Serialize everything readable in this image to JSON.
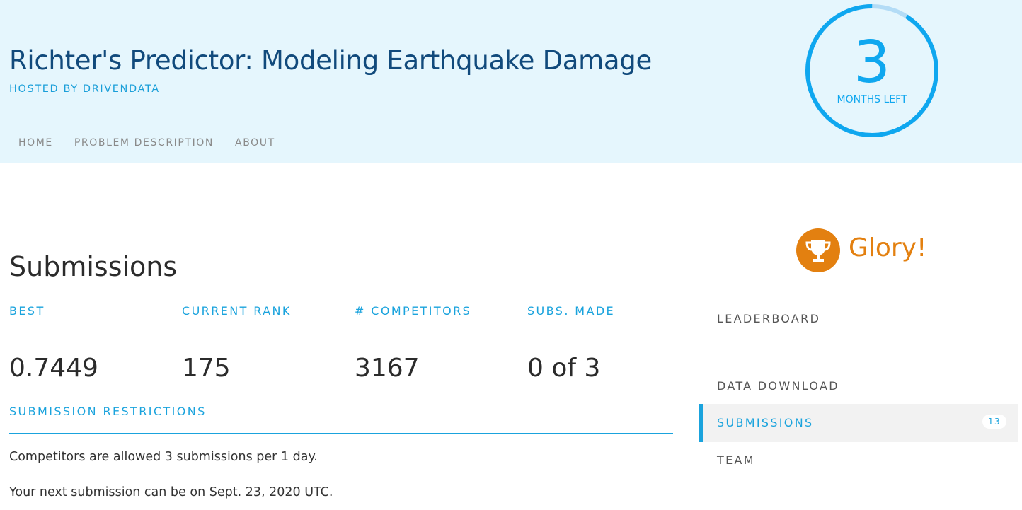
{
  "header": {
    "title": "Richter's Predictor: Modeling Earthquake Damage",
    "host": "HOSTED BY DRIVENDATA",
    "nav": [
      "HOME",
      "PROBLEM DESCRIPTION",
      "ABOUT"
    ],
    "countdown": {
      "value": "3",
      "label": "MONTHS LEFT",
      "fraction_remaining": 0.91
    }
  },
  "main": {
    "title": "Submissions",
    "stats": [
      {
        "label": "BEST",
        "value": "0.7449"
      },
      {
        "label": "CURRENT RANK",
        "value": "175"
      },
      {
        "label": "# COMPETITORS",
        "value": "3167"
      },
      {
        "label": "SUBS. MADE",
        "value": "0 of 3"
      }
    ],
    "restrictions": {
      "heading": "SUBMISSION RESTRICTIONS",
      "lines": [
        "Competitors are allowed 3 submissions per 1 day.",
        "Your next submission can be on Sept. 23, 2020 UTC."
      ]
    }
  },
  "sidebar": {
    "prize": {
      "icon": "trophy-icon",
      "text": "Glory!"
    },
    "items": [
      {
        "label": "LEADERBOARD"
      },
      {
        "label": "DATA DOWNLOAD"
      },
      {
        "label": "SUBMISSIONS",
        "badge": "13",
        "active": true
      },
      {
        "label": "TEAM"
      }
    ]
  },
  "colors": {
    "header_bg": "#e5f6fd",
    "accent": "#1aa3dd",
    "title_blue": "#114a7c",
    "glory_orange": "#e38010"
  }
}
